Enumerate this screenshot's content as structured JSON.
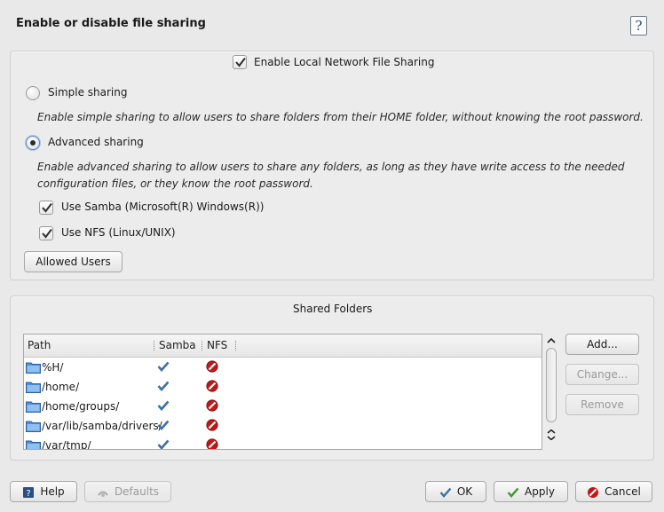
{
  "window": {
    "title": "Enable or disable file sharing",
    "help_glyph": "?"
  },
  "sharing": {
    "enable_local": {
      "label": "Enable Local Network File Sharing",
      "checked": true
    },
    "simple": {
      "label": "Simple sharing",
      "selected": false,
      "description": "Enable simple sharing to allow users to share folders from their HOME folder, without knowing the root password."
    },
    "advanced": {
      "label": "Advanced sharing",
      "selected": true,
      "description_line1": "Enable advanced sharing to allow users to share any folders, as long as they have write access to the needed",
      "description_line2": "configuration files, or they know the root password."
    },
    "use_samba": {
      "label": "Use Samba (Microsoft(R) Windows(R))",
      "checked": true
    },
    "use_nfs": {
      "label": "Use NFS (Linux/UNIX)",
      "checked": true
    },
    "allowed_users_label": "Allowed Users"
  },
  "shared_folders": {
    "title": "Shared Folders",
    "columns": [
      "Path",
      "Samba",
      "NFS"
    ],
    "rows": [
      {
        "path": "%H/",
        "samba": "enabled",
        "nfs": "disabled"
      },
      {
        "path": "/home/",
        "samba": "enabled",
        "nfs": "disabled"
      },
      {
        "path": "/home/groups/",
        "samba": "enabled",
        "nfs": "disabled"
      },
      {
        "path": "/var/lib/samba/drivers/",
        "samba": "enabled",
        "nfs": "disabled"
      },
      {
        "path": "/var/tmp/",
        "samba": "enabled",
        "nfs": "disabled"
      }
    ],
    "add_label": "Add...",
    "change_label": "Change...",
    "remove_label": "Remove"
  },
  "footer": {
    "help_label": "Help",
    "defaults_label": "Defaults",
    "ok_label": "OK",
    "apply_label": "Apply",
    "cancel_label": "Cancel"
  },
  "colors": {
    "check_blue": "#3f6fa6",
    "disabled_red": "#c01818",
    "folder_blue": "#4f8fd6",
    "ok_green": "#3a9a2a"
  }
}
